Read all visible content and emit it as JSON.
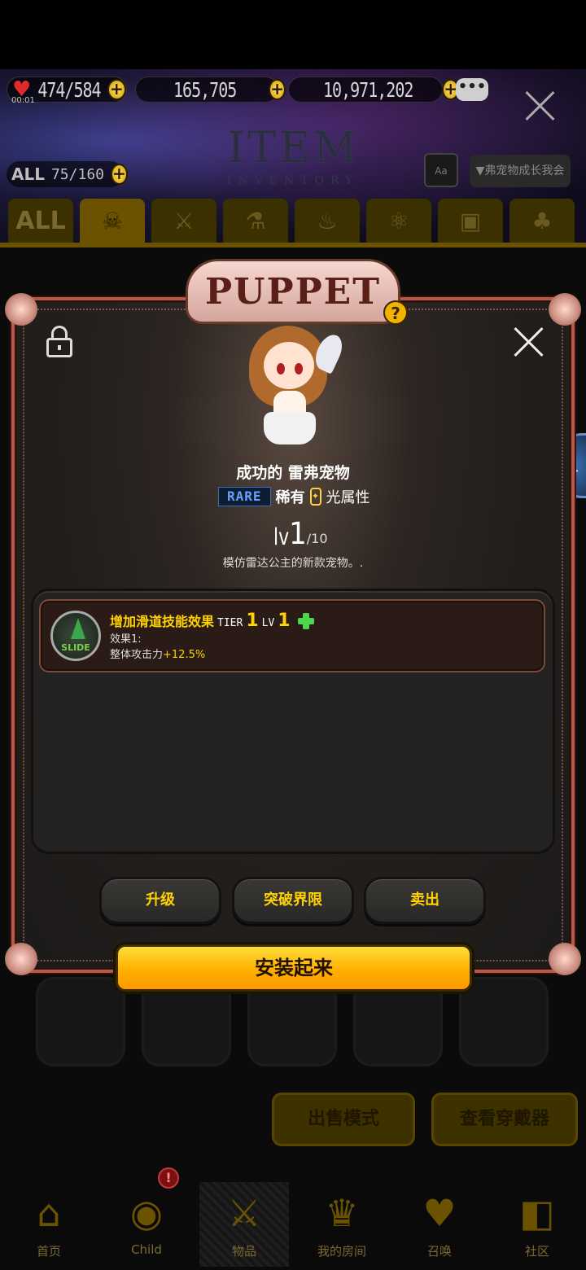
{
  "header": {
    "timer": "00:01",
    "hearts": "474/584",
    "gems": "165,705",
    "gold": "10,971,202",
    "title": "ITEM",
    "subtitle": "INVENTORY",
    "all_label": "ALL",
    "count": "75/160",
    "aa_label": "Aa",
    "filter_label": "▼弗宠物成长我会"
  },
  "category_tabs": [
    "ALL",
    "puppet",
    "sword",
    "potion",
    "spa",
    "atom",
    "chest",
    "cook"
  ],
  "modal": {
    "banner": "PUPPET",
    "help": "?",
    "pet_name": "成功的 雷弗宠物",
    "rarity_badge": "RARE",
    "rarity_text": "稀有",
    "attribute_icon": "✦",
    "attribute_text": "光属性",
    "level_prefix": "lv",
    "level_current": "1",
    "level_max": "/10",
    "description": "模仿雷达公主的新款宠物。.",
    "skill": {
      "icon_text": "SLIDE",
      "name": "增加滑道技能效果",
      "tier_label": "TIER",
      "tier_value": "1",
      "lv_label": "LV",
      "lv_value": "1",
      "effect_label": "效果1:",
      "effect_name": "整体攻击力",
      "effect_value": "+12.5%"
    },
    "buttons": {
      "upgrade": "升级",
      "breakthrough": "突破界限",
      "sell": "卖出",
      "install": "安装起来"
    }
  },
  "side_badge": "水",
  "inventory_actions": {
    "sell_mode": "出售模式",
    "view_wear": "查看穿戴器"
  },
  "nav": {
    "alert": "!",
    "items": [
      {
        "label": "首页",
        "icon": "home-icon"
      },
      {
        "label": "Child",
        "icon": "child-flame-icon"
      },
      {
        "label": "物品",
        "icon": "sword-shield-icon"
      },
      {
        "label": "我的房间",
        "icon": "crown-wreath-icon"
      },
      {
        "label": "召唤",
        "icon": "summon-bottle-icon"
      },
      {
        "label": "社区",
        "icon": "community-shield-icon"
      }
    ]
  }
}
